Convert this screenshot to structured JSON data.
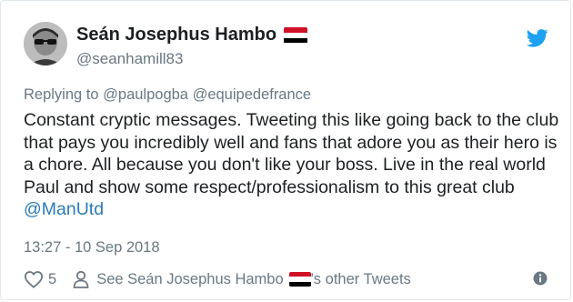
{
  "user": {
    "display_name": "Seán Josephus Hambo",
    "handle": "@seanhamill83",
    "flag_colors": [
      "#ce1126",
      "#ffffff",
      "#000000"
    ]
  },
  "reply": {
    "prefix": "Replying to",
    "mentions": [
      "@paulpogba",
      "@equipedefrance"
    ]
  },
  "body": {
    "text": "Constant cryptic messages. Tweeting this like going back to the club that pays you incredibly well and fans that adore you as their hero is a chore. All because you don't like your boss. Live in the real world Paul and show some respect/professionalism to this great club ",
    "link": "@ManUtd"
  },
  "timestamp": "13:27 - 10 Sep 2018",
  "actions": {
    "like_count": "5",
    "see_prefix": "See Seán Josephus Hambo",
    "see_suffix": "'s other Tweets"
  },
  "icons": {
    "brand": "twitter-bird-icon",
    "like": "heart-icon",
    "profile": "person-icon",
    "info": "info-icon"
  },
  "colors": {
    "brand_blue": "#1da1f2",
    "link": "#2b7bb9",
    "muted": "#697882",
    "text": "#1c2022"
  }
}
